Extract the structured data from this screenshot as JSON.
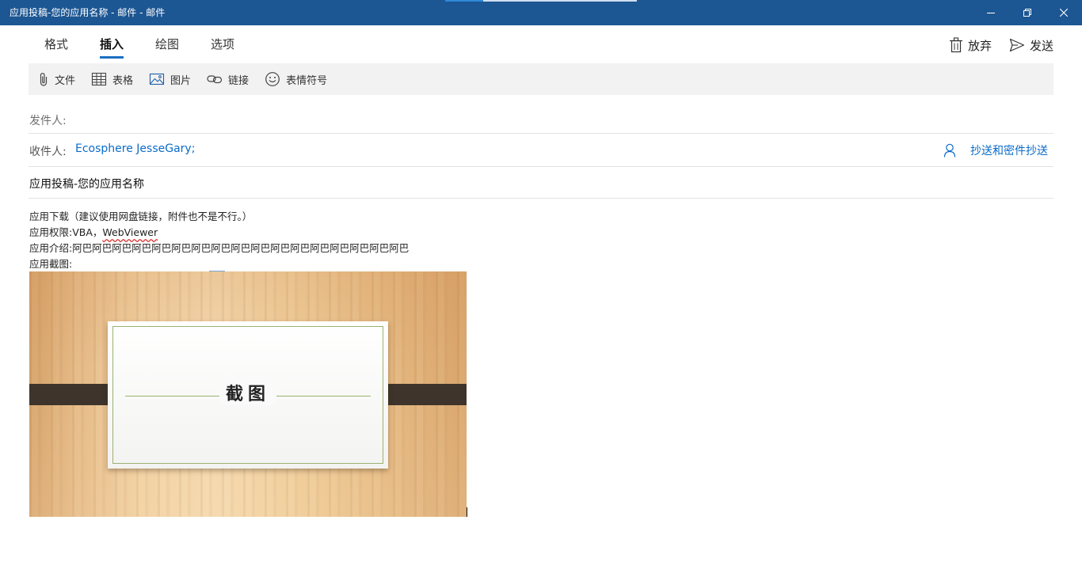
{
  "window": {
    "title": "应用投稿-您的应用名称 - 邮件 - 邮件",
    "progress": 0.2,
    "buttons": {
      "minimize": "minimize-icon",
      "restore": "restore-icon",
      "close": "close-icon"
    }
  },
  "tabs": [
    {
      "label": "格式",
      "active": false
    },
    {
      "label": "插入",
      "active": true
    },
    {
      "label": "绘图",
      "active": false
    },
    {
      "label": "选项",
      "active": false
    }
  ],
  "actions": {
    "discard": "放弃",
    "send": "发送"
  },
  "ribbon": {
    "file": "文件",
    "table": "表格",
    "picture": "图片",
    "link": "链接",
    "emoji": "表情符号"
  },
  "header": {
    "from_label": "发件人:",
    "from_value": "",
    "to_label": "收件人:",
    "to_value": "Ecosphere JesseGary;",
    "cc_bcc": "抄送和密件抄送",
    "subject": "应用投稿-您的应用名称"
  },
  "body": {
    "line1": "应用下载（建议使用网盘链接，附件也不是不行。）",
    "line2_prefix": "应用权限:VBA，",
    "line2_misspelled": "WebViewer",
    "line3": "应用介绍:阿巴阿巴阿巴阿巴阿巴阿巴阿巴阿巴阿巴阿巴阿巴阿巴阿巴阿巴阿巴阿巴阿巴",
    "line4": "应用截图:",
    "image_caption": "截图"
  },
  "colors": {
    "titlebar": "#1c5693",
    "accent": "#1b6fc4",
    "link": "#0a6cc9"
  }
}
